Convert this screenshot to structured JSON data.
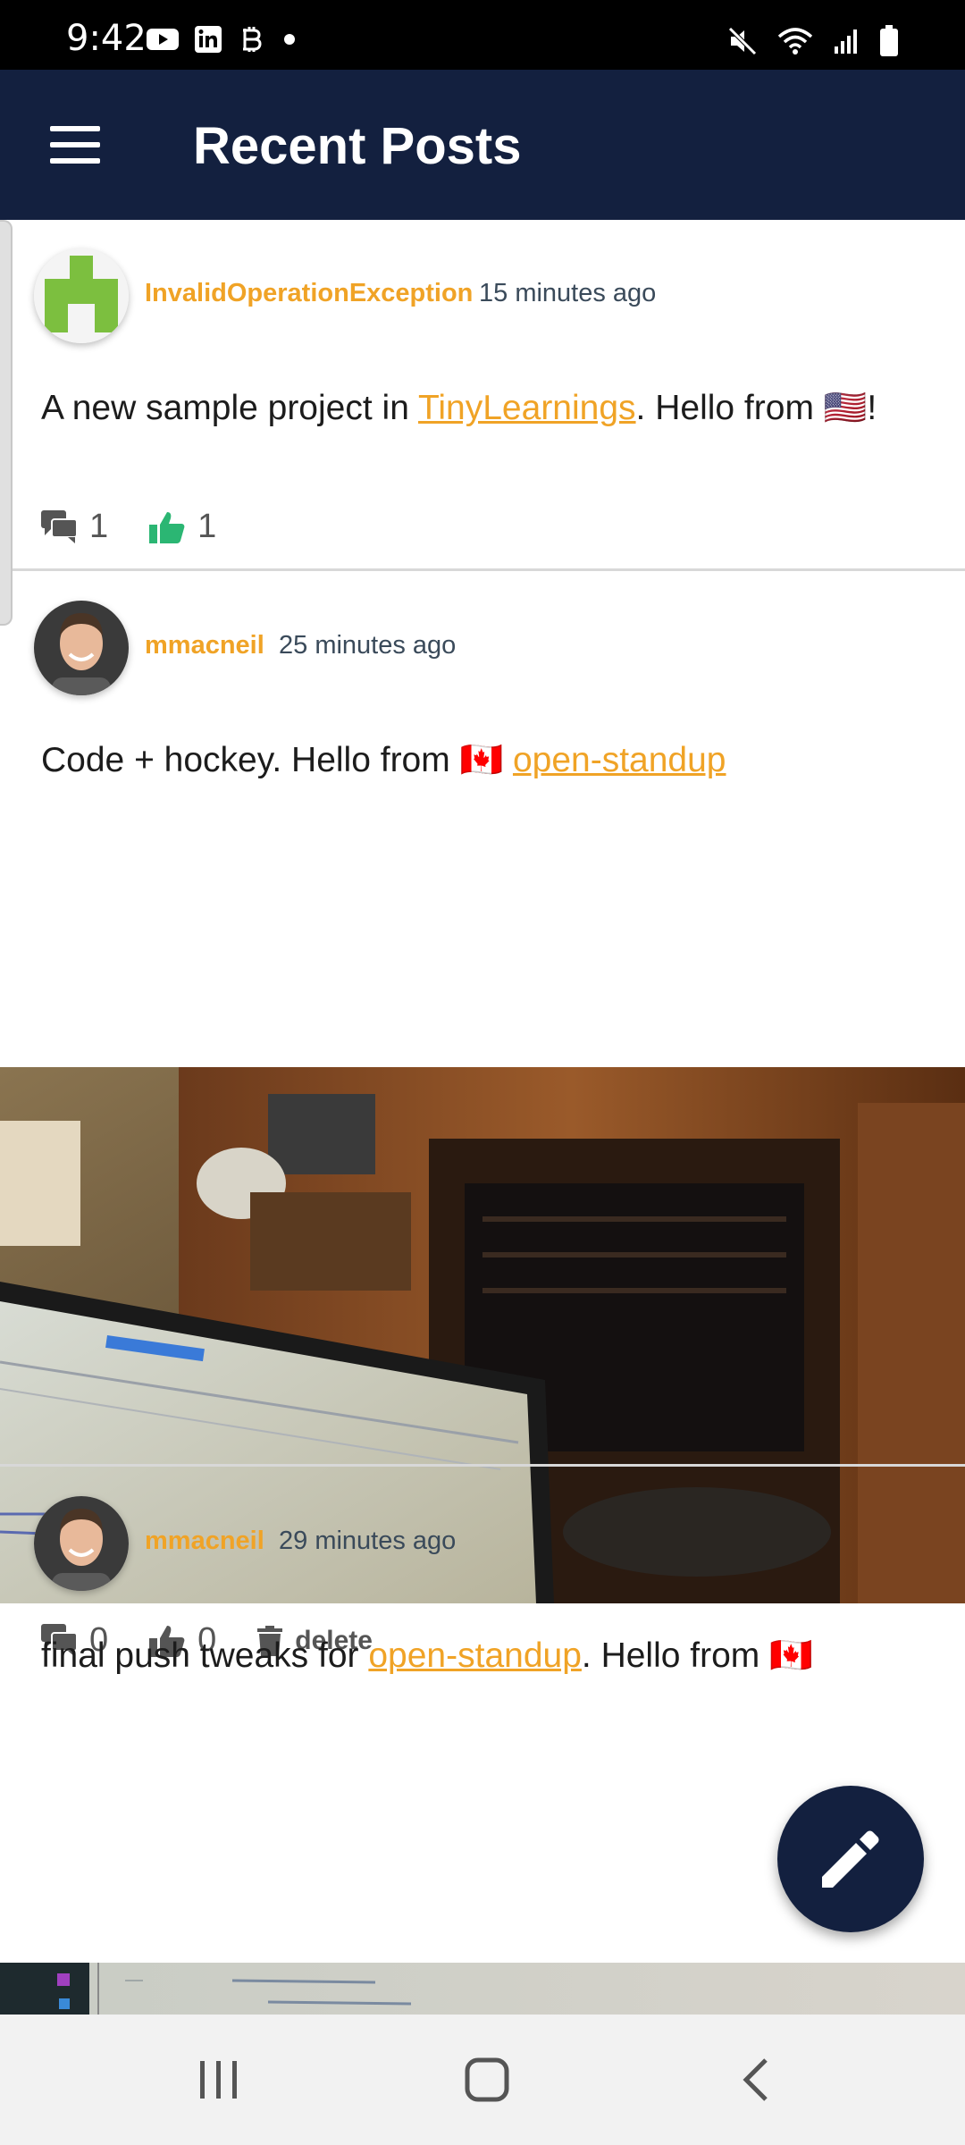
{
  "status_bar": {
    "time": "9:42",
    "left_icons": [
      "youtube-icon",
      "linkedin-icon",
      "bitcoin-icon",
      "dot-icon"
    ],
    "right_icons": [
      "mute-icon",
      "wifi-icon",
      "signal-icon",
      "battery-icon"
    ]
  },
  "app_bar": {
    "title": "Recent Posts",
    "menu_icon": "hamburger-menu-icon",
    "background": "#13203f"
  },
  "colors": {
    "accent": "#f0a326",
    "like_active": "#2bb673",
    "icon_gray": "#555555"
  },
  "posts": [
    {
      "author": "InvalidOperationException",
      "time": "15 minutes ago",
      "text_before": "A new sample project in ",
      "link": "TinyLearnings",
      "text_after": ". Hello from 🇺🇸!",
      "comments": "1",
      "likes": "1",
      "liked": true
    },
    {
      "author": "mmacneil",
      "time": "25 minutes ago",
      "text_before": "Code + hockey. Hello from 🇨🇦 ",
      "link": "open-standup",
      "text_after": "",
      "comments": "0",
      "likes": "0",
      "liked": false,
      "delete_label": "delete",
      "has_image": true
    },
    {
      "author": "mmacneil",
      "time": "29 minutes ago",
      "text_before": "final push tweaks for ",
      "link": "open-standup",
      "text_after": ". Hello from 🇨🇦",
      "has_image": true
    }
  ],
  "fab": {
    "icon": "pencil-icon"
  },
  "nav_bar": {
    "buttons": [
      "recent-apps-icon",
      "home-icon",
      "back-icon"
    ]
  }
}
